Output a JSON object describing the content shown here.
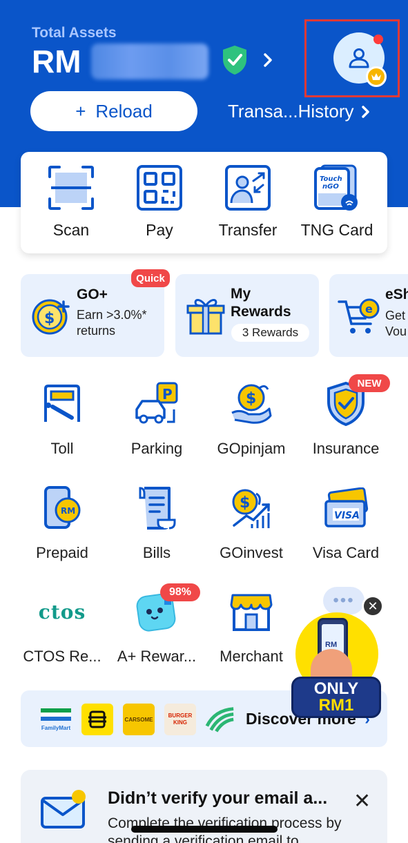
{
  "header": {
    "assets_label": "Total Assets",
    "currency": "RM",
    "amount_hidden": "•••••",
    "reload_label": "Reload",
    "transaction_history_label": "Transa...History",
    "colors": {
      "brand_blue": "#0a55c9",
      "highlight_red": "#e53935"
    }
  },
  "quick_actions": [
    {
      "label": "Scan",
      "icon": "scan-icon"
    },
    {
      "label": "Pay",
      "icon": "qr-code-icon"
    },
    {
      "label": "Transfer",
      "icon": "transfer-icon"
    },
    {
      "label": "TNG Card",
      "icon": "tng-card-icon"
    }
  ],
  "promos": {
    "goplus": {
      "badge": "Quick",
      "title": "GO+",
      "sub1": "Earn >3.0%*",
      "sub2": "returns"
    },
    "rewards": {
      "title1": "My",
      "title2": "Rewards",
      "pill": "3 Rewards"
    },
    "eshop": {
      "title": "eSh",
      "sub1": "Get",
      "sub2": "Vou"
    }
  },
  "services": [
    {
      "label": "Toll",
      "icon": "toll-icon"
    },
    {
      "label": "Parking",
      "icon": "parking-icon"
    },
    {
      "label": "GOpinjam",
      "icon": "gopinjam-icon"
    },
    {
      "label": "Insurance",
      "icon": "insurance-icon",
      "badge": "NEW"
    },
    {
      "label": "Prepaid",
      "icon": "prepaid-icon"
    },
    {
      "label": "Bills",
      "icon": "bills-icon"
    },
    {
      "label": "GOinvest",
      "icon": "goinvest-icon"
    },
    {
      "label": "Visa Card",
      "icon": "visa-card-icon"
    },
    {
      "label": "CTOS Re...",
      "icon": "ctos-icon",
      "logo_text": "ctos"
    },
    {
      "label": "A+ Rewar...",
      "icon": "a-plus-rewards-icon",
      "badge": "98%"
    },
    {
      "label": "Merchant",
      "icon": "merchant-icon"
    }
  ],
  "partners": {
    "familymart": "FamilyMart",
    "carsome": "CARSOME",
    "burgerking1": "BURGER",
    "burgerking2": "KING",
    "discover": "Discover more"
  },
  "floating_ad": {
    "rm_label": "RM",
    "line1": "ONLY",
    "line2": "RM1"
  },
  "verify": {
    "title": "Didn’t verify your email a...",
    "text": "Complete the verification process by sending a verification email to"
  }
}
